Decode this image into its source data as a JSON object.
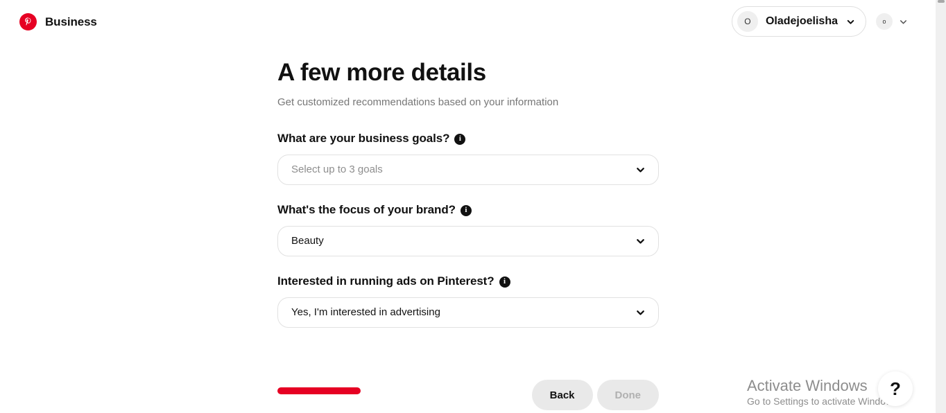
{
  "header": {
    "logo_icon": "pinterest-logo-icon",
    "brand_name": "Business",
    "account": {
      "avatar_initial": "O",
      "name": "Oladejoelisha",
      "chevron_icon": "chevron-down-icon"
    },
    "secondary_account": {
      "avatar_initial": "o",
      "chevron_icon": "chevron-down-icon"
    }
  },
  "main": {
    "title": "A few more details",
    "subtitle": "Get customized recommendations based on your information",
    "info_icon_glyph": "i",
    "fields": [
      {
        "label": "What are your business goals?",
        "info_icon": "info-icon",
        "value": "Select up to 3 goals",
        "is_placeholder": true,
        "chevron_icon": "chevron-down-icon"
      },
      {
        "label": "What's the focus of your brand?",
        "info_icon": "info-icon",
        "value": "Beauty",
        "is_placeholder": false,
        "chevron_icon": "chevron-down-icon"
      },
      {
        "label": "Interested in running ads on Pinterest?",
        "info_icon": "info-icon",
        "value": "Yes, I'm interested in advertising",
        "is_placeholder": false,
        "chevron_icon": "chevron-down-icon"
      }
    ]
  },
  "footer": {
    "progress_color": "#e60023",
    "progress_percent": 100,
    "back_label": "Back",
    "done_label": "Done",
    "done_disabled": true
  },
  "watermark": {
    "title": "Activate Windows",
    "subtitle": "Go to Settings to activate Windows."
  },
  "help": {
    "glyph": "?"
  },
  "colors": {
    "brand_red": "#e60023",
    "text_primary": "#111111",
    "text_muted": "#767676",
    "border": "#e1e1e1",
    "button_bg": "#e9e9e9"
  }
}
